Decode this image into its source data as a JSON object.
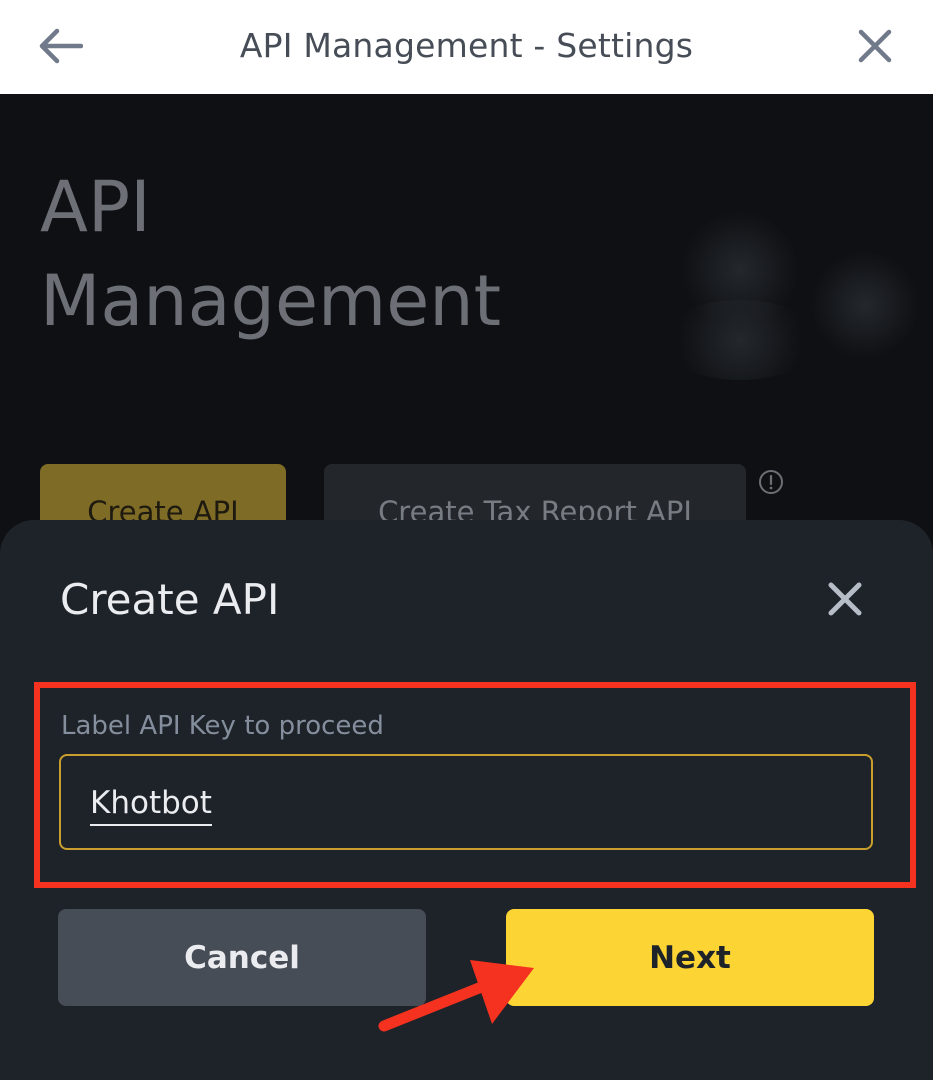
{
  "topbar": {
    "title": "API Management - Settings",
    "back_icon": "arrow-left-icon",
    "close_icon": "close-icon"
  },
  "background_page": {
    "hero_title_line1": "API",
    "hero_title_line2": "Management",
    "create_api_label": "Create API",
    "create_tax_report_label": "Create Tax Report API",
    "info_icon": "info-icon"
  },
  "dialog": {
    "title": "Create API",
    "close_icon": "close-icon",
    "field_label": "Label API Key to proceed",
    "field_value": "Khotbot",
    "cancel_label": "Cancel",
    "next_label": "Next"
  },
  "annotations": {
    "highlight_color": "#f5311f",
    "arrow_color": "#f5311f"
  },
  "colors": {
    "accent": "#fcd535",
    "sheet_bg": "#1e2329",
    "input_border": "#c99e2c"
  }
}
